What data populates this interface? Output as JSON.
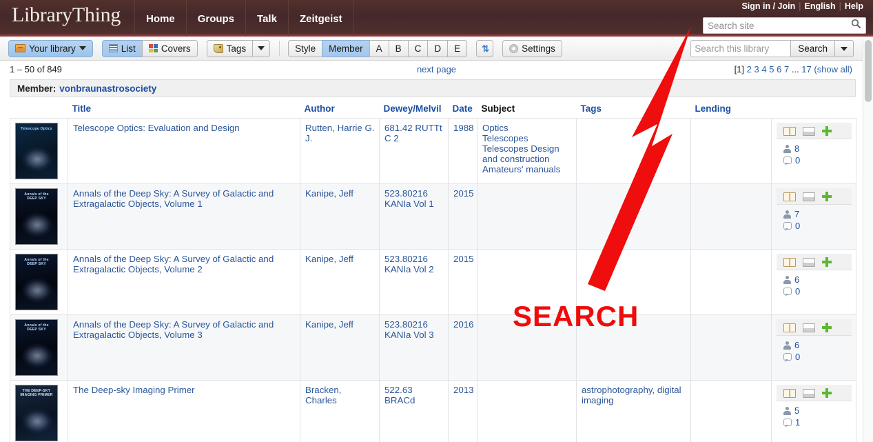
{
  "site": {
    "brand": "LibraryThing",
    "nav": [
      {
        "label": "Home"
      },
      {
        "label": "Groups"
      },
      {
        "label": "Talk"
      },
      {
        "label": "Zeitgeist"
      }
    ],
    "top_links": {
      "signin": "Sign in / Join",
      "language": "English",
      "help": "Help",
      "separator": "|"
    },
    "site_search": {
      "placeholder": "Search site",
      "value": "",
      "icon": "search-icon"
    }
  },
  "toolbar": {
    "your_library": "Your library",
    "view_list": "List",
    "view_covers": "Covers",
    "view_tags": "Tags",
    "style": "Style",
    "member": "Member",
    "letters": [
      "A",
      "B",
      "C",
      "D",
      "E"
    ],
    "sort_icon": "⇅",
    "settings": "Settings",
    "library_search": {
      "placeholder": "Search this library",
      "value": "",
      "button": "Search"
    }
  },
  "status": {
    "count": "1 – 50 of 849",
    "next_page": "next page",
    "pager": {
      "current": "[1]",
      "pages": [
        "2",
        "3",
        "4",
        "5",
        "6",
        "7"
      ],
      "ellipsis": "...",
      "last": "17",
      "show_all": "(show all)"
    }
  },
  "member_bar": {
    "label": "Member:",
    "name": "vonbraunastrosociety"
  },
  "table": {
    "columns": [
      {
        "key": "cover",
        "label": "",
        "sorted": false
      },
      {
        "key": "title",
        "label": "Title",
        "sorted": false
      },
      {
        "key": "author",
        "label": "Author",
        "sorted": false
      },
      {
        "key": "dewey",
        "label": "Dewey/Melvil",
        "sorted": false
      },
      {
        "key": "date",
        "label": "Date",
        "sorted": false
      },
      {
        "key": "subject",
        "label": "Subject",
        "sorted": true
      },
      {
        "key": "tags",
        "label": "Tags",
        "sorted": false
      },
      {
        "key": "lending",
        "label": "Lending",
        "sorted": false
      },
      {
        "key": "actions",
        "label": "",
        "sorted": false
      }
    ],
    "rows": [
      {
        "title": "Telescope Optics: Evaluation and Design",
        "author": "Rutten, Harrie G. J.",
        "dewey": "681.42 RUTTt C 2",
        "date": "1988",
        "subjects": [
          "Optics",
          "Telescopes",
          "Telescopes Design and construction",
          "Amateurs' manuals"
        ],
        "tags": "",
        "lending": "",
        "members": "8",
        "comments": "0",
        "cover_title": "Telescope Optics"
      },
      {
        "title": "Annals of the Deep Sky: A Survey of Galactic and Extragalactic Objects, Volume 1",
        "author": "Kanipe, Jeff",
        "dewey": "523.80216 KANIa Vol 1",
        "date": "2015",
        "subjects": [],
        "tags": "",
        "lending": "",
        "members": "7",
        "comments": "0",
        "cover_title": "Annals of the DEEP SKY"
      },
      {
        "title": "Annals of the Deep Sky: A Survey of Galactic and Extragalactic Objects, Volume 2",
        "author": "Kanipe, Jeff",
        "dewey": "523.80216 KANIa Vol 2",
        "date": "2015",
        "subjects": [],
        "tags": "",
        "lending": "",
        "members": "6",
        "comments": "0",
        "cover_title": "Annals of the DEEP SKY"
      },
      {
        "title": "Annals of the Deep Sky: A Survey of Galactic and Extragalactic Objects, Volume 3",
        "author": "Kanipe, Jeff",
        "dewey": "523.80216 KANIa Vol 3",
        "date": "2016",
        "subjects": [],
        "tags": "",
        "lending": "",
        "members": "6",
        "comments": "0",
        "cover_title": "Annals of the DEEP SKY"
      },
      {
        "title": "The Deep-sky Imaging Primer",
        "author": "Bracken, Charles",
        "dewey": "522.63 BRACd",
        "date": "2013",
        "subjects": [],
        "tags": "astrophotography, digital imaging",
        "lending": "",
        "members": "5",
        "comments": "1",
        "cover_title": "THE DEEP-SKY IMAGING PRIMER"
      }
    ]
  },
  "annotation": {
    "label": "SEARCH",
    "color": "#f00b0b",
    "arrow": "arrow-pointing-to-library-search"
  }
}
